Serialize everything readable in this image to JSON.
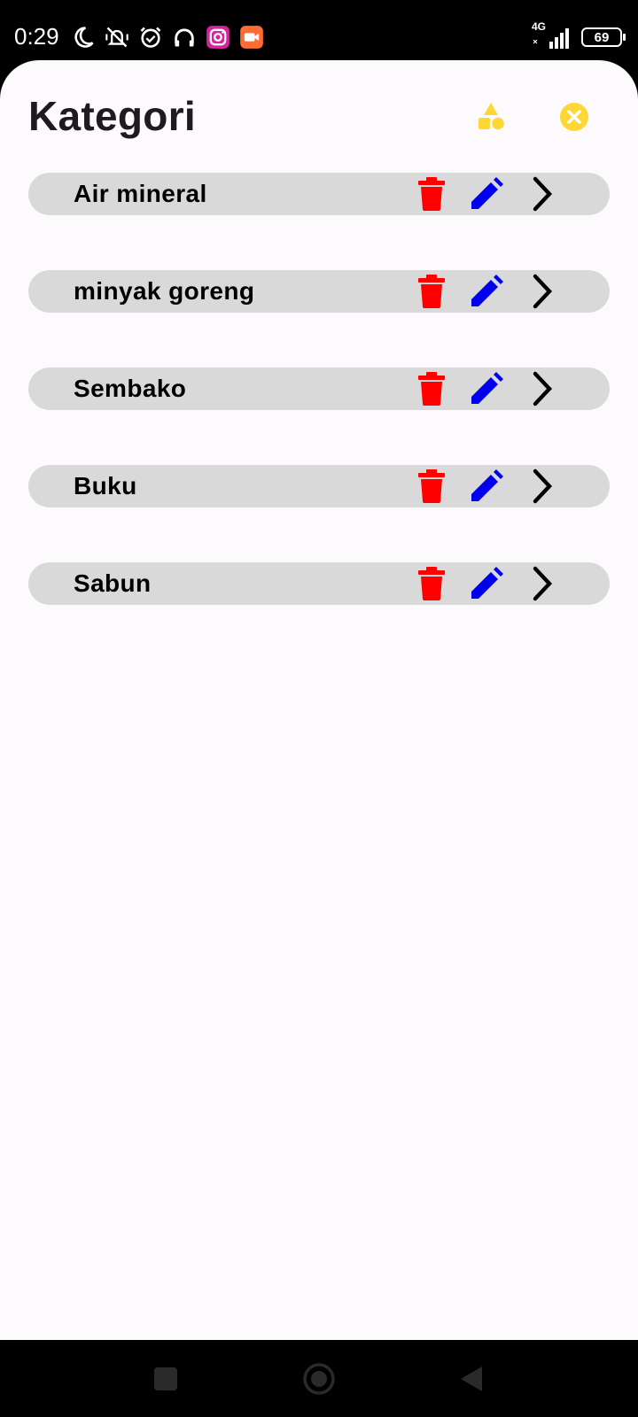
{
  "status_bar": {
    "time": "0:29",
    "network": "4G",
    "battery": "69",
    "icons": [
      "moon-icon",
      "vibrate-off-icon",
      "alarm-icon",
      "headphones-icon",
      "instagram-icon",
      "video-recorder-icon",
      "signal-icon",
      "battery-icon"
    ]
  },
  "header": {
    "title": "Kategori",
    "actions": [
      "shapes-icon",
      "close-circle-icon"
    ]
  },
  "categories": [
    {
      "name": "Air mineral"
    },
    {
      "name": "minyak goreng"
    },
    {
      "name": "Sembako"
    },
    {
      "name": "Buku"
    },
    {
      "name": "Sabun"
    }
  ],
  "row_actions": [
    "delete-icon",
    "edit-icon",
    "chevron-right-icon"
  ],
  "colors": {
    "accent": "#fdd835",
    "delete": "#ff0000",
    "edit": "#0000ee",
    "row_bg": "#d9d9d9",
    "sheet_bg": "#fcfafd"
  },
  "nav_bar": [
    "recent-apps-icon",
    "home-icon",
    "back-icon"
  ]
}
